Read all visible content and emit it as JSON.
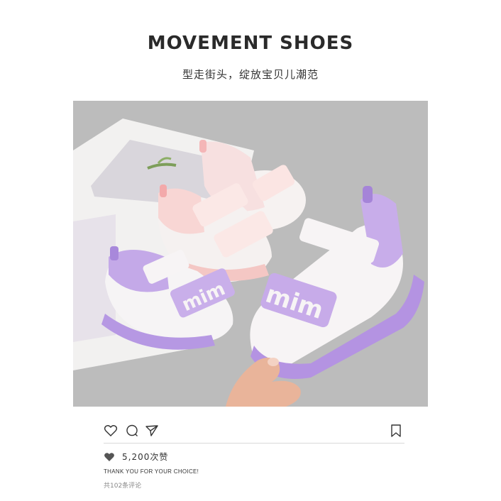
{
  "header": {
    "title": "MOVEMENT SHOES",
    "subtitle": "型走街头，绽放宝贝儿潮范"
  },
  "photo": {
    "sandal_logo_text": "mim",
    "colors": {
      "background": "#bdbdbd",
      "lilac": "#b89be0",
      "pink": "#f6c8c6",
      "white": "#f7f5f4"
    }
  },
  "actions": {
    "icons": [
      "heart-outline-icon",
      "comment-icon",
      "share-icon",
      "bookmark-icon"
    ]
  },
  "post": {
    "likes": "5,200次赞",
    "caption": "THANK YOU FOR YOUR CHOICE!",
    "comments": "共102条评论"
  }
}
